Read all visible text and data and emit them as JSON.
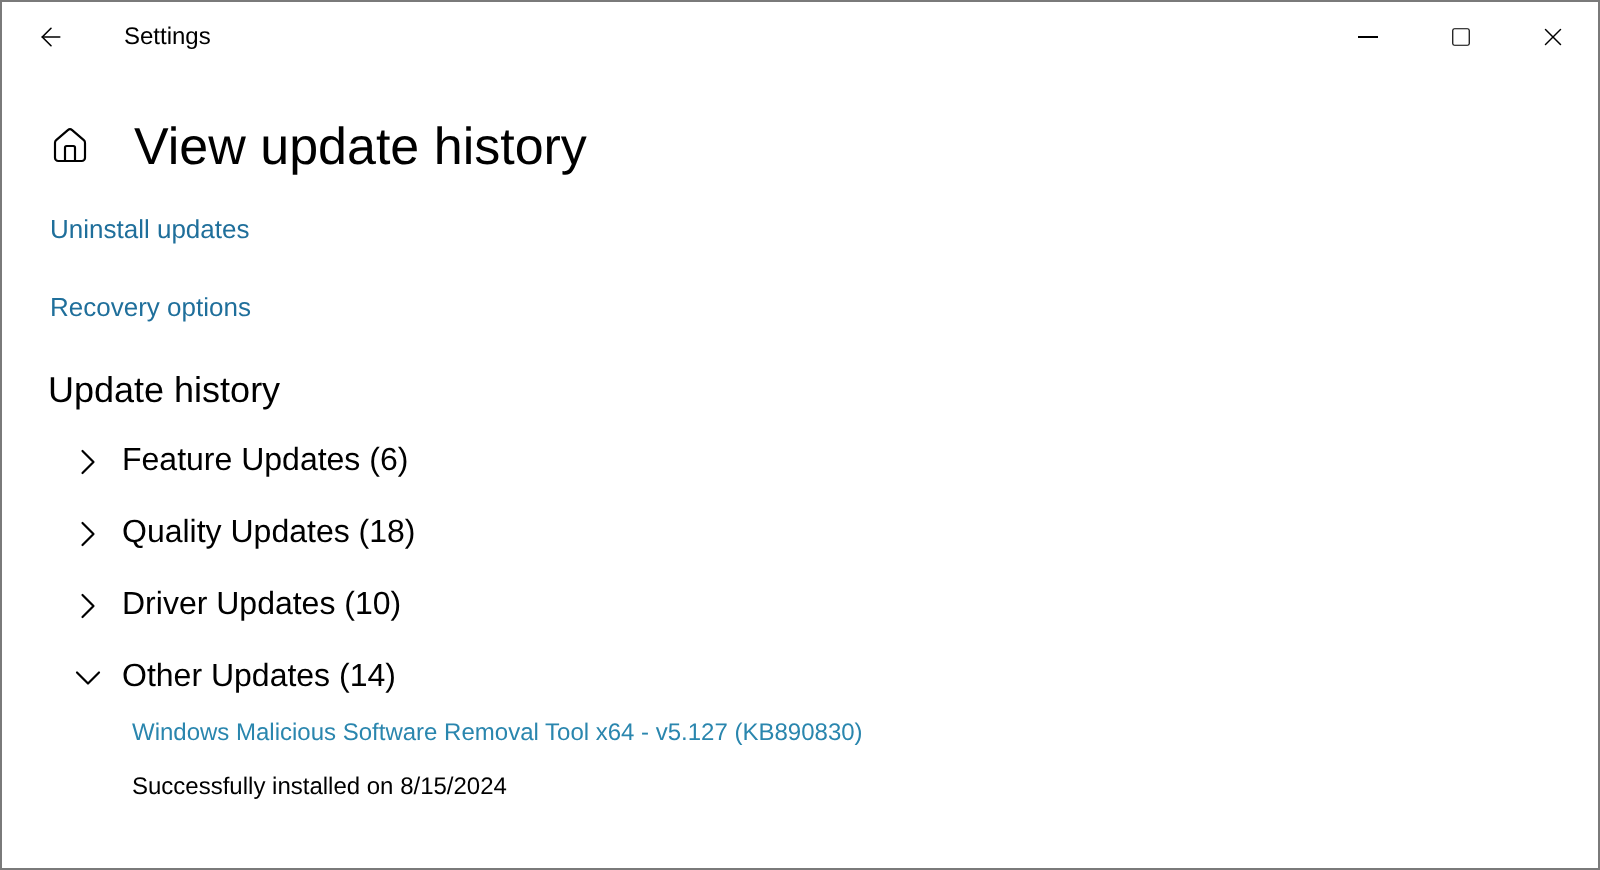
{
  "window": {
    "title": "Settings"
  },
  "page_title": "View update history",
  "links": [
    "Uninstall updates",
    "Recovery options"
  ],
  "section_title": "Update history",
  "groups": [
    {
      "label": "Feature Updates (6)",
      "expanded": false
    },
    {
      "label": "Quality Updates (18)",
      "expanded": false
    },
    {
      "label": "Driver Updates (10)",
      "expanded": false
    },
    {
      "label": "Other Updates (14)",
      "expanded": true,
      "entries": [
        {
          "name": "Windows Malicious Software Removal Tool x64 - v5.127 (KB890830)",
          "status": "Successfully installed on 8/15/2024"
        }
      ]
    }
  ]
}
